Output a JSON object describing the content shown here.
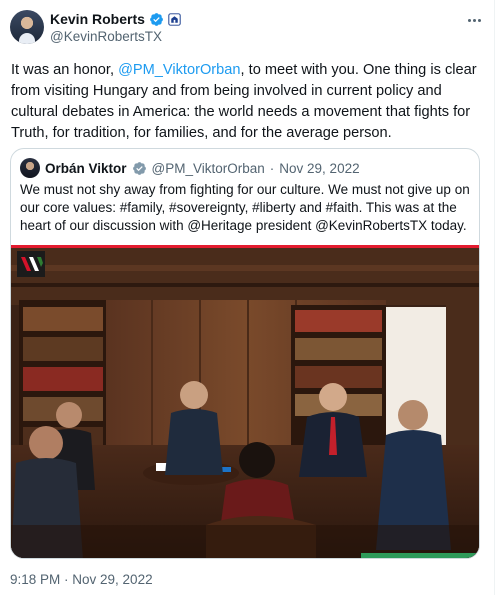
{
  "author": {
    "name": "Kevin Roberts",
    "handle": "@KevinRobertsTX",
    "verified_icon": "verified-badge-icon",
    "affiliation_icon": "affiliation-badge-icon"
  },
  "tweet": {
    "text_before": "It was an honor, ",
    "mention": "@PM_ViktorOrban",
    "text_after": ", to meet with you. One thing is clear from visiting Hungary and from being involved in current policy and cultural debates in America: the world needs a movement that fights for Truth, for tradition, for families, and for the average person."
  },
  "quote": {
    "name": "Orbán Viktor",
    "handle": "@PM_ViktorOrban",
    "separator": "·",
    "date": "Nov 29, 2022",
    "text": "We must not shy away from fighting for our culture. We must not give up on our core values: #family, #sovereignty, #liberty and #faith. This was at the heart of our discussion with @Heritage president @KevinRobertsTX today."
  },
  "timestamp": "9:18 PM · Nov 29, 2022",
  "colors": {
    "accent": "#1d9bf0",
    "secondary_text": "#536471",
    "border": "#cfd9de",
    "logo_red": "#d3122a",
    "logo_green": "#2e7d32"
  }
}
